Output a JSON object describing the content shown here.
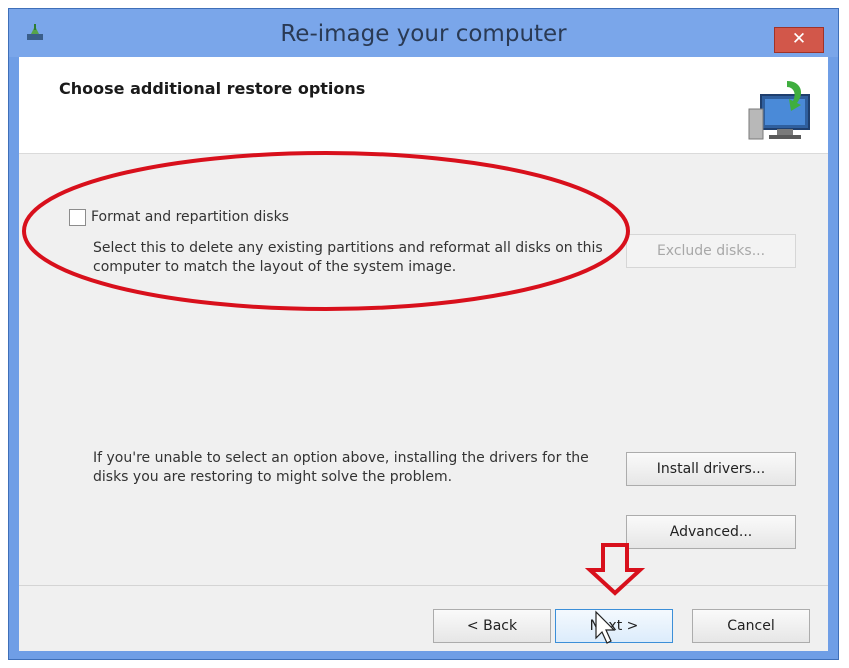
{
  "window": {
    "title": "Re-image your computer",
    "close_glyph": "✕"
  },
  "header": {
    "title": "Choose additional restore options",
    "icon": "restore-computer-icon"
  },
  "format_option": {
    "checkbox_label": "Format and repartition disks",
    "checked": false,
    "description": "Select this to delete any existing partitions and reformat all disks on this computer to match the layout of the system image.",
    "exclude_button": "Exclude disks...",
    "exclude_enabled": false
  },
  "drivers": {
    "text": "If you're unable to select an option above, installing the drivers for the disks you are restoring to might solve the problem.",
    "install_button": "Install drivers...",
    "advanced_button": "Advanced..."
  },
  "footer": {
    "back_button": "< Back",
    "next_button": "Next >",
    "cancel_button": "Cancel"
  },
  "colors": {
    "annotation": "#d8101c",
    "titlebar": "#7aa6ea",
    "close_button": "#d2574a"
  },
  "annotations": {
    "highlight_ellipse": "red-ellipse-around-format-option",
    "arrow": "red-down-arrow-above-next"
  }
}
